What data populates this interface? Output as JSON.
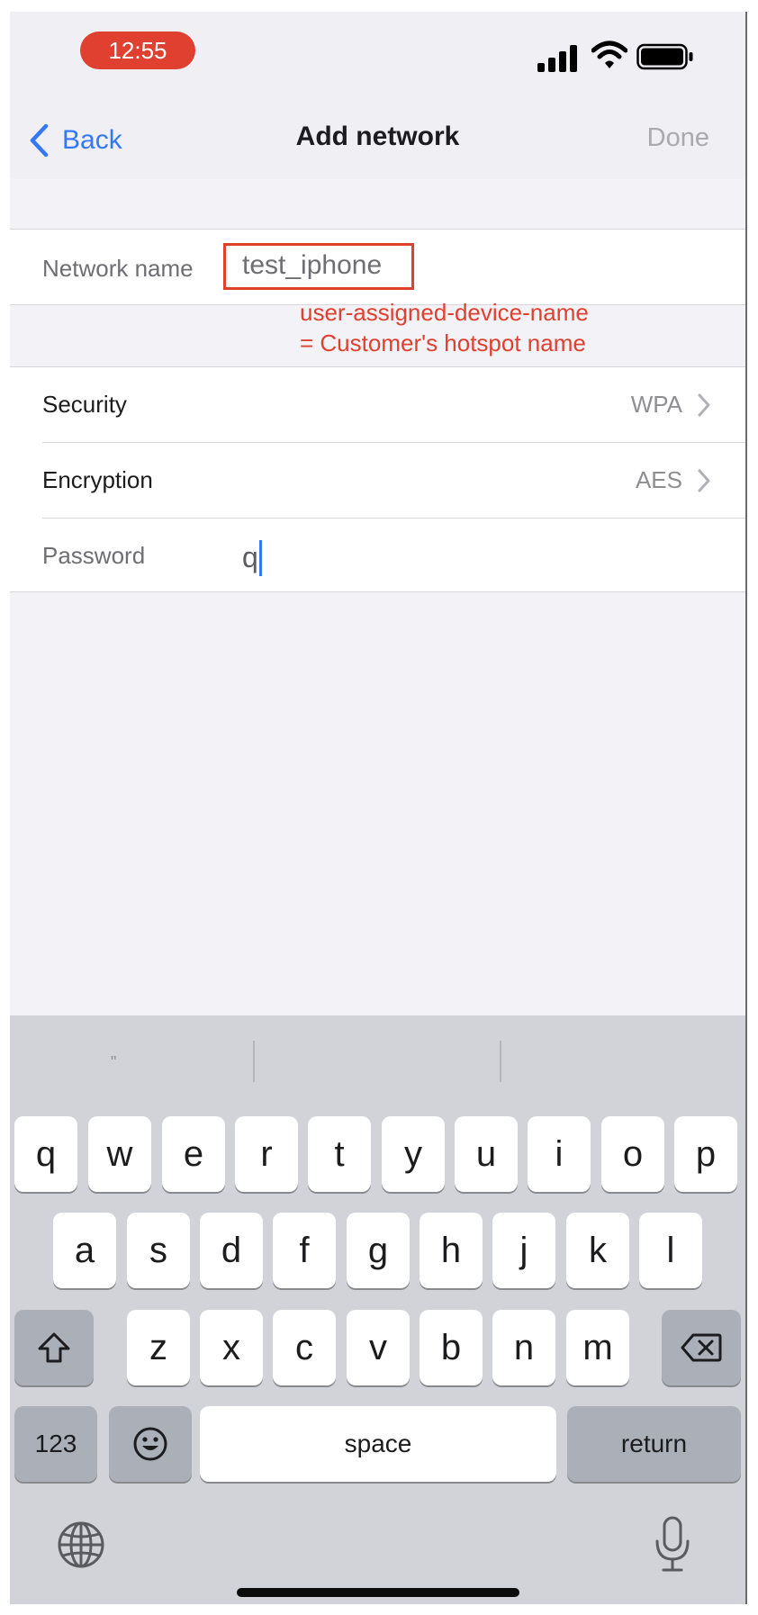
{
  "status_bar": {
    "time": "12:55"
  },
  "nav": {
    "back_label": "Back",
    "title": "Add network",
    "done_label": "Done"
  },
  "form": {
    "network_name_label": "Network name",
    "network_name_value": "test_iphone",
    "annotation_line1": "user-assigned-device-name",
    "annotation_line2": "= Customer's hotspot name",
    "security_label": "Security",
    "security_value": "WPA",
    "encryption_label": "Encryption",
    "encryption_value": "AES",
    "password_label": "Password",
    "password_value": "q"
  },
  "keyboard": {
    "suggestion": "\"",
    "row1": [
      "q",
      "w",
      "e",
      "r",
      "t",
      "y",
      "u",
      "i",
      "o",
      "p"
    ],
    "row2": [
      "a",
      "s",
      "d",
      "f",
      "g",
      "h",
      "j",
      "k",
      "l"
    ],
    "row3": [
      "z",
      "x",
      "c",
      "v",
      "b",
      "n",
      "m"
    ],
    "numbers_label": "123",
    "space_label": "space",
    "return_label": "return"
  },
  "icons": {
    "signal": "cellular-signal-icon",
    "wifi": "wifi-icon",
    "battery": "battery-icon",
    "shift": "shift-arrow-icon",
    "delete": "delete-backspace-icon",
    "emoji": "emoji-face-icon",
    "globe": "globe-icon",
    "mic": "microphone-icon"
  },
  "colors": {
    "accent": "#3478f6",
    "annotation": "#e0402f",
    "time_pill": "#e0402f"
  }
}
